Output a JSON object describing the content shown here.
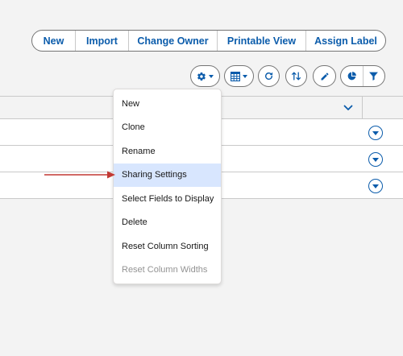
{
  "top_actions": {
    "new_label": "New",
    "import_label": "Import",
    "change_owner_label": "Change Owner",
    "printable_view_label": "Printable View",
    "assign_label_label": "Assign Label"
  },
  "toolbar": {
    "icons": [
      "gear-icon",
      "table-icon",
      "refresh-icon",
      "sort-icon",
      "pencil-icon",
      "pie-chart-icon",
      "filter-icon"
    ]
  },
  "menu": {
    "items": [
      {
        "label": "New"
      },
      {
        "label": "Clone"
      },
      {
        "label": "Rename"
      },
      {
        "label": "Sharing Settings",
        "highlighted": true
      },
      {
        "label": "Select Fields to Display"
      },
      {
        "label": "Delete"
      },
      {
        "label": "Reset Column Sorting"
      },
      {
        "label": "Reset Column Widths",
        "disabled": true
      }
    ]
  },
  "table": {
    "row_count": 3
  },
  "colors": {
    "brand_blue": "#0b5cab",
    "highlight": "#d8e6fe",
    "annotation_red": "#c23934"
  }
}
